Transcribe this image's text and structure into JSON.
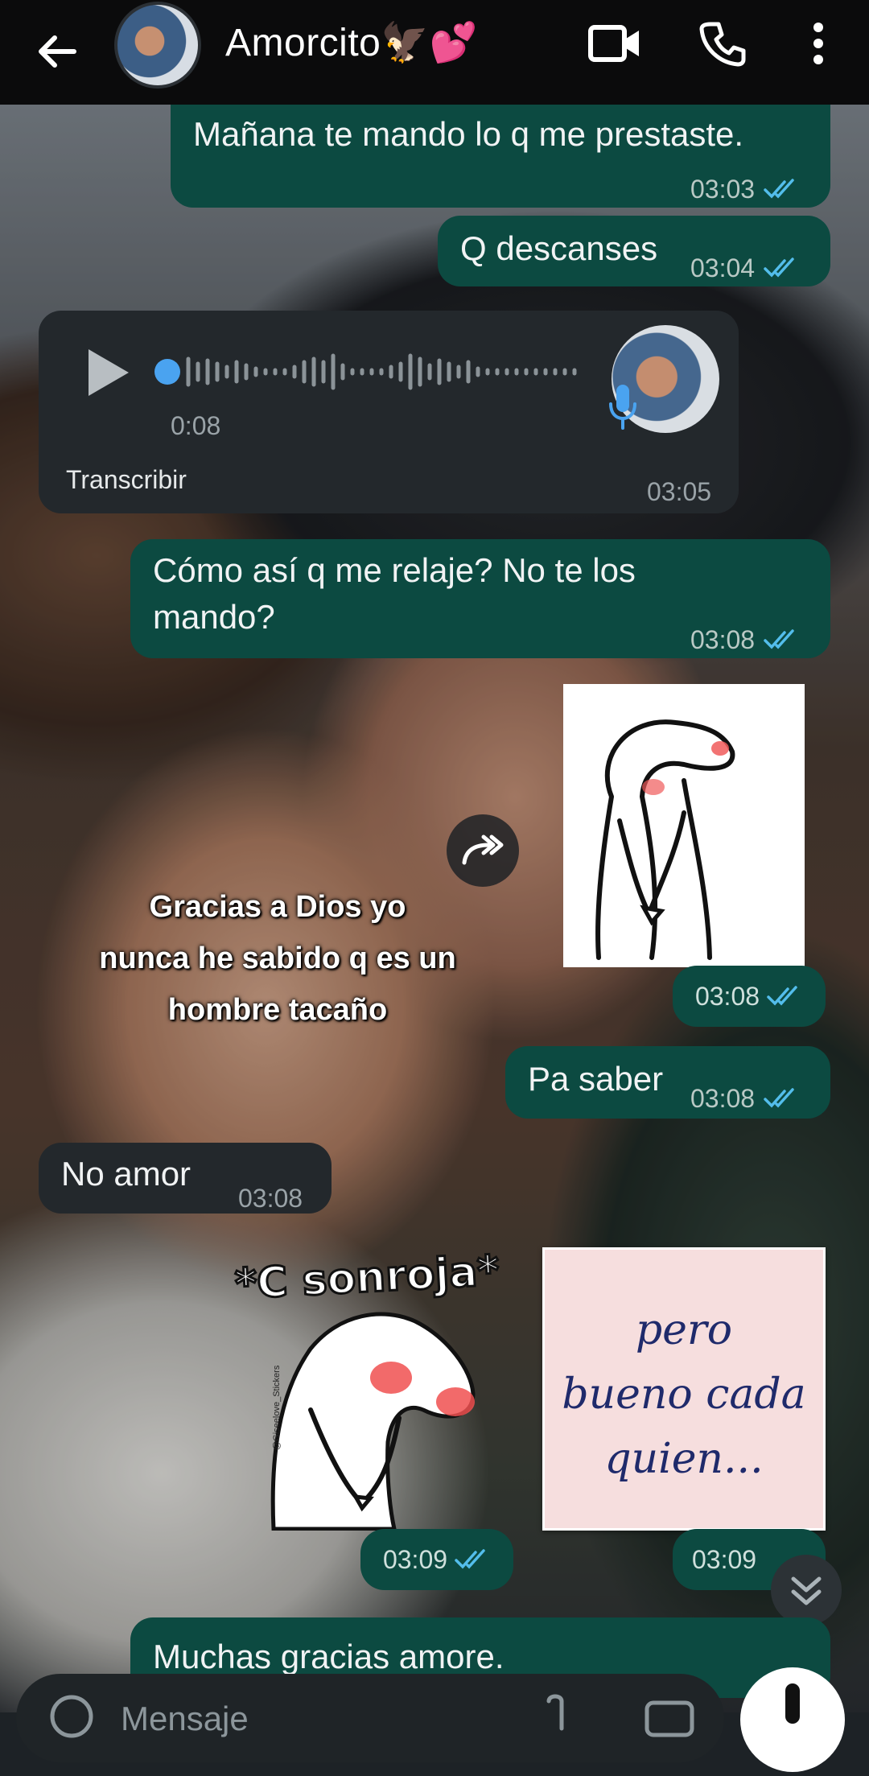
{
  "header": {
    "title": "Amorcito🦅💕"
  },
  "messages": {
    "m1": {
      "text": "Mañana te mando lo q me prestaste.",
      "time": "03:03"
    },
    "m2": {
      "text": "Q descanses",
      "time": "03:04"
    },
    "voice": {
      "duration": "0:08",
      "transcribe": "Transcribir",
      "time": "03:05"
    },
    "m3": {
      "line1": "Cómo así q me relaje? No te los",
      "line2": "mando?",
      "time": "03:08"
    },
    "sticker1": {
      "time": "03:08",
      "overlay": [
        "Gracias a Dios yo",
        "nunca he sabido q es un",
        "hombre tacaño"
      ]
    },
    "m4": {
      "text": "Pa saber",
      "time": "03:08"
    },
    "m5": {
      "text": "No amor",
      "time": "03:08"
    },
    "sticker2": {
      "caption": "*C sonroja*",
      "credit": "@Giseelove_Stickers",
      "time": "03:09"
    },
    "sticker3": {
      "line1": "pero",
      "line2": "bueno cada",
      "line3": "quien...",
      "time": "03:09"
    },
    "m6": {
      "text": "Muchas gracias amore."
    }
  },
  "composer": {
    "placeholder": "Mensaje"
  },
  "colors": {
    "outgoing_bubble": "#0c4a41",
    "incoming_bubble": "#23282c",
    "read_ticks": "#53bdeb",
    "voice_dot": "#4aa3f0"
  },
  "icons": [
    "back-arrow-icon",
    "video-call-icon",
    "phone-icon",
    "more-vert-icon",
    "play-icon",
    "mic-icon",
    "double-check-icon",
    "forward-icon",
    "chevron-double-down-icon",
    "emoji-icon",
    "attach-icon",
    "camera-icon"
  ]
}
